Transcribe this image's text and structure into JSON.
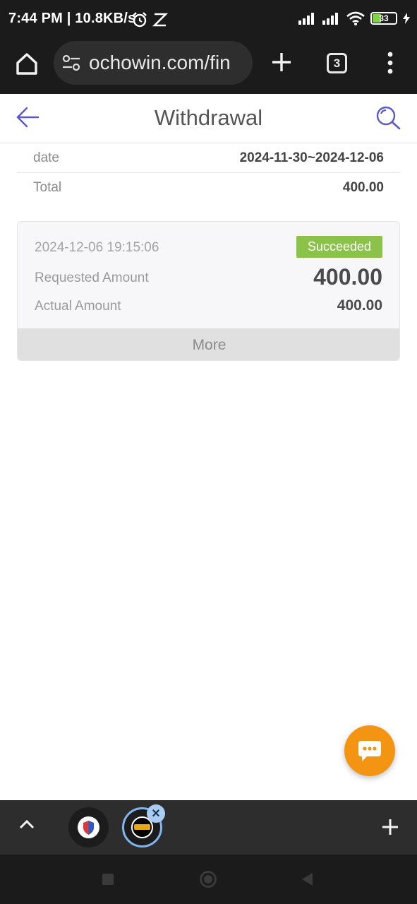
{
  "status_bar": {
    "time_speed": "7:44 PM | 10.8KB/s",
    "battery": "33"
  },
  "browser": {
    "url": "ochowin.com/fin",
    "tab_count": "3"
  },
  "header": {
    "title": "Withdrawal"
  },
  "summary": {
    "rows": [
      {
        "label": "date",
        "value": "2024-11-30~2024-12-06"
      },
      {
        "label": "Total",
        "value": "400.00"
      }
    ]
  },
  "record": {
    "datetime": "2024-12-06 19:15:06",
    "status": "Succeeded",
    "requested_label": "Requested Amount",
    "requested_value": "400.00",
    "actual_label": "Actual Amount",
    "actual_value": "400.00",
    "more_label": "More"
  },
  "colors": {
    "accent": "#5a58c8",
    "success": "#8bc34a",
    "fab": "#f39412"
  },
  "icons": {
    "back": "arrow-left-icon",
    "search": "search-icon",
    "chat": "chat-bubble-icon"
  }
}
